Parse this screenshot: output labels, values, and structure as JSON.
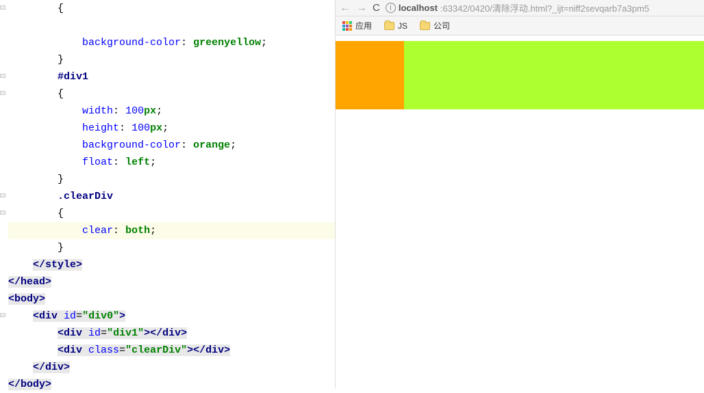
{
  "editor": {
    "lines": [
      {
        "indent": 2,
        "tokens": [
          {
            "t": "{",
            "c": "punct"
          }
        ]
      },
      {
        "indent": 2,
        "tokens": []
      },
      {
        "indent": 3,
        "tokens": [
          {
            "t": "background-color",
            "c": "attr"
          },
          {
            "t": ": ",
            "c": "punct"
          },
          {
            "t": "greenyellow",
            "c": "val"
          },
          {
            "t": ";",
            "c": "punct"
          }
        ]
      },
      {
        "indent": 2,
        "tokens": [
          {
            "t": "}",
            "c": "punct"
          }
        ]
      },
      {
        "indent": 2,
        "tokens": [
          {
            "t": "#div1",
            "c": "sel"
          }
        ]
      },
      {
        "indent": 2,
        "tokens": [
          {
            "t": "{",
            "c": "punct"
          }
        ]
      },
      {
        "indent": 3,
        "tokens": [
          {
            "t": "width",
            "c": "attr"
          },
          {
            "t": ": ",
            "c": "punct"
          },
          {
            "t": "100",
            "c": "valnum"
          },
          {
            "t": "px",
            "c": "val"
          },
          {
            "t": ";",
            "c": "punct"
          }
        ]
      },
      {
        "indent": 3,
        "tokens": [
          {
            "t": "height",
            "c": "attr"
          },
          {
            "t": ": ",
            "c": "punct"
          },
          {
            "t": "100",
            "c": "valnum"
          },
          {
            "t": "px",
            "c": "val"
          },
          {
            "t": ";",
            "c": "punct"
          }
        ]
      },
      {
        "indent": 3,
        "tokens": [
          {
            "t": "background-color",
            "c": "attr"
          },
          {
            "t": ": ",
            "c": "punct"
          },
          {
            "t": "orange",
            "c": "val"
          },
          {
            "t": ";",
            "c": "punct"
          }
        ]
      },
      {
        "indent": 3,
        "tokens": [
          {
            "t": "float",
            "c": "attr"
          },
          {
            "t": ": ",
            "c": "punct"
          },
          {
            "t": "left",
            "c": "val"
          },
          {
            "t": ";",
            "c": "punct"
          }
        ]
      },
      {
        "indent": 2,
        "tokens": [
          {
            "t": "}",
            "c": "punct"
          }
        ]
      },
      {
        "indent": 2,
        "tokens": [
          {
            "t": ".clearDiv",
            "c": "sel"
          }
        ]
      },
      {
        "indent": 2,
        "tokens": [
          {
            "t": "{",
            "c": "punct"
          }
        ]
      },
      {
        "indent": 3,
        "hl": true,
        "tokens": [
          {
            "t": "clear",
            "c": "attr"
          },
          {
            "t": ": ",
            "c": "punct"
          },
          {
            "t": "both",
            "c": "val"
          },
          {
            "t": ";",
            "c": "punct"
          }
        ]
      },
      {
        "indent": 2,
        "tokens": [
          {
            "t": "}",
            "c": "punct"
          }
        ]
      },
      {
        "indent": 1,
        "tokens": [
          {
            "t": "</",
            "c": "tag",
            "bg": true
          },
          {
            "t": "style",
            "c": "tag",
            "bg": true
          },
          {
            "t": ">",
            "c": "tag",
            "bg": true
          }
        ]
      },
      {
        "indent": 0,
        "tokens": [
          {
            "t": "</",
            "c": "tag",
            "bg": true
          },
          {
            "t": "head",
            "c": "tag",
            "bg": true
          },
          {
            "t": ">",
            "c": "tag",
            "bg": true
          }
        ]
      },
      {
        "indent": 0,
        "tokens": [
          {
            "t": "<",
            "c": "tag",
            "bg": true
          },
          {
            "t": "body",
            "c": "tag",
            "bg": true
          },
          {
            "t": ">",
            "c": "tag",
            "bg": true
          }
        ]
      },
      {
        "indent": 1,
        "tokens": [
          {
            "t": "<",
            "c": "tag",
            "bg": true
          },
          {
            "t": "div ",
            "c": "tag",
            "bg": true
          },
          {
            "t": "id",
            "c": "attr",
            "bg": true
          },
          {
            "t": "=",
            "c": "punct",
            "bg": true
          },
          {
            "t": "\"div0\"",
            "c": "str",
            "bg": true
          },
          {
            "t": ">",
            "c": "tag",
            "bg": true
          }
        ]
      },
      {
        "indent": 2,
        "tokens": [
          {
            "t": "<",
            "c": "tag",
            "bg": true
          },
          {
            "t": "div ",
            "c": "tag",
            "bg": true
          },
          {
            "t": "id",
            "c": "attr",
            "bg": true
          },
          {
            "t": "=",
            "c": "punct",
            "bg": true
          },
          {
            "t": "\"div1\"",
            "c": "str",
            "bg": true
          },
          {
            "t": "></",
            "c": "tag",
            "bg": true
          },
          {
            "t": "div",
            "c": "tag",
            "bg": true
          },
          {
            "t": ">",
            "c": "tag",
            "bg": true
          }
        ]
      },
      {
        "indent": 2,
        "tokens": [
          {
            "t": "<",
            "c": "tag",
            "bg": true
          },
          {
            "t": "div ",
            "c": "tag",
            "bg": true
          },
          {
            "t": "class",
            "c": "attr",
            "bg": true
          },
          {
            "t": "=",
            "c": "punct",
            "bg": true
          },
          {
            "t": "\"clearDiv\"",
            "c": "str",
            "bg": true
          },
          {
            "t": "></",
            "c": "tag",
            "bg": true
          },
          {
            "t": "div",
            "c": "tag",
            "bg": true
          },
          {
            "t": ">",
            "c": "tag",
            "bg": true
          }
        ]
      },
      {
        "indent": 1,
        "tokens": [
          {
            "t": "</",
            "c": "tag",
            "bg": true
          },
          {
            "t": "div",
            "c": "tag",
            "bg": true
          },
          {
            "t": ">",
            "c": "tag",
            "bg": true
          }
        ]
      },
      {
        "indent": 0,
        "tokens": [
          {
            "t": "</",
            "c": "tag",
            "bg": true
          },
          {
            "t": "body",
            "c": "tag",
            "bg": true
          },
          {
            "t": ">",
            "c": "tag",
            "bg": true
          }
        ]
      }
    ]
  },
  "browser": {
    "nav_back": "←",
    "nav_forward": "→",
    "reload": "C",
    "url_info": "i",
    "url_host": "localhost",
    "url_path": ":63342/0420/清除浮动.html?_ijt=niff2sevqarb7a3pm5",
    "bookmarks": {
      "apps": "应用",
      "js": "JS",
      "company": "公司"
    }
  },
  "render": {
    "green_bg": "greenyellow",
    "orange_bg": "orange",
    "orange_w": 100,
    "orange_h": 100
  }
}
